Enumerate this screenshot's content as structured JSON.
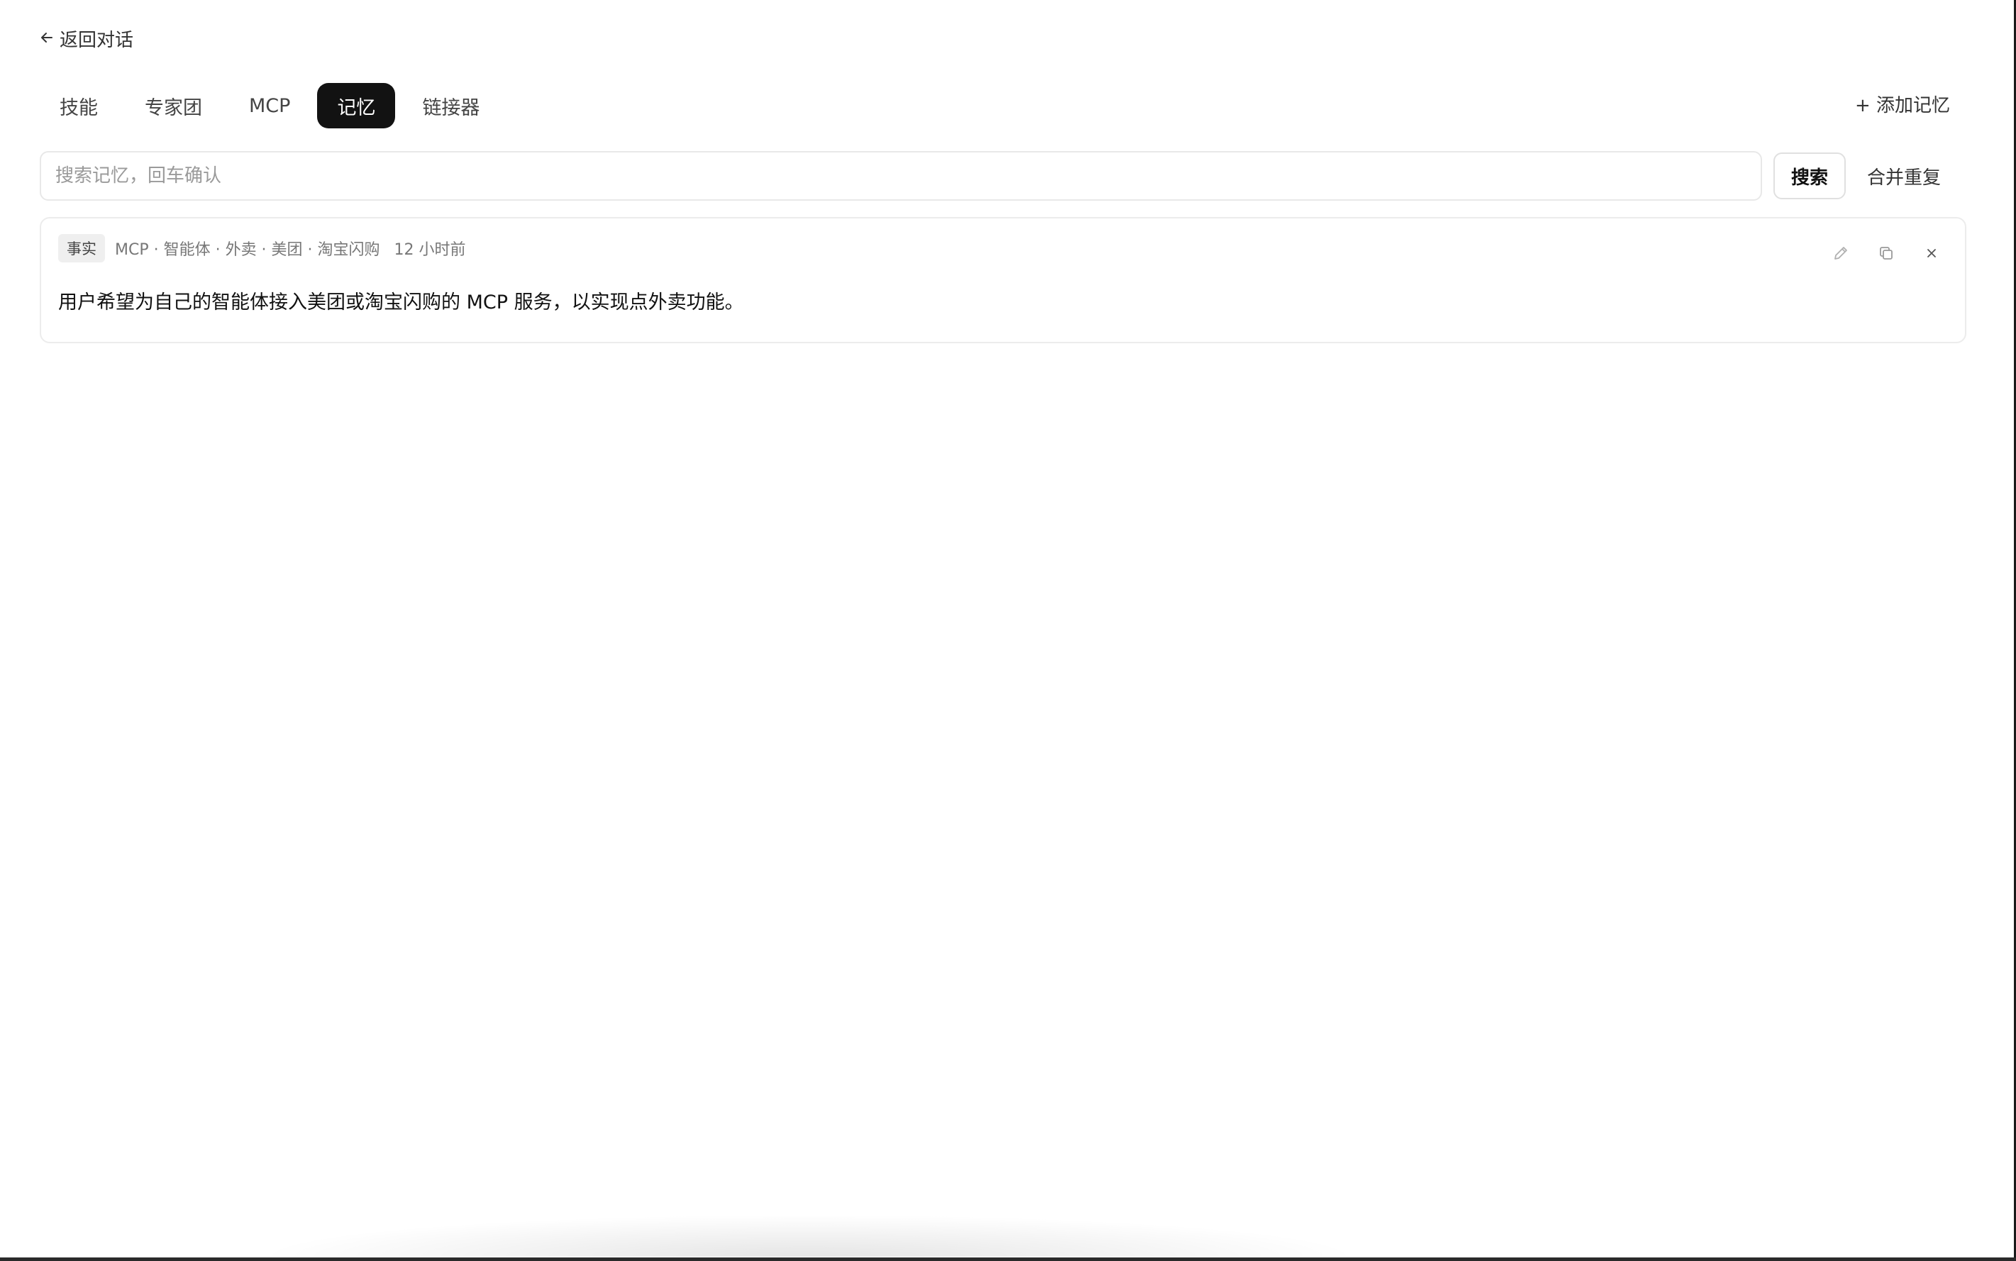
{
  "header": {
    "back_label": "返回对话"
  },
  "tabs": [
    {
      "label": "技能",
      "active": false
    },
    {
      "label": "专家团",
      "active": false
    },
    {
      "label": "MCP",
      "active": false
    },
    {
      "label": "记忆",
      "active": true
    },
    {
      "label": "链接器",
      "active": false
    }
  ],
  "toolbar": {
    "add_memory_label": "+ 添加记忆"
  },
  "search": {
    "placeholder": "搜索记忆，回车确认",
    "value": "",
    "search_label": "搜索",
    "merge_label": "合并重复"
  },
  "memories": [
    {
      "type": "事实",
      "tags": "MCP · 智能体 · 外卖 · 美团 · 淘宝闪购",
      "time": "12 小时前",
      "content": "用户希望为自己的智能体接入美团或淘宝闪购的 MCP 服务，以实现点外卖功能。",
      "actions": [
        "edit-icon",
        "copy-icon",
        "close-icon"
      ]
    }
  ],
  "colors": {
    "active_tab_bg": "#121212",
    "active_tab_text": "#ffffff",
    "border": "#ececec",
    "muted_text": "#777777"
  }
}
